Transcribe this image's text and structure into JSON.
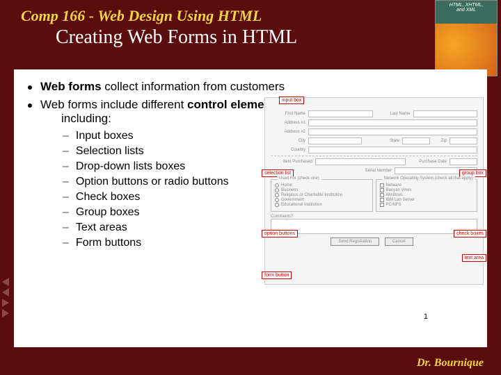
{
  "header": {
    "course": "Comp 166 - Web Design Using HTML",
    "title": "Creating Web Forms in HTML"
  },
  "book": {
    "line1": "HTML, XHTML,",
    "line2": "and XML"
  },
  "bullets": {
    "b1_pre": "Web forms",
    "b1_post": " collect information from customers",
    "b2_pre": "Web forms include different ",
    "b2_bold": "control elements",
    "b2_post": " including:",
    "subs": {
      "s1": "Input boxes",
      "s2": "Selection lists",
      "s3": "Drop-down lists boxes",
      "s4": "Option buttons or radio buttons",
      "s5": "Check boxes",
      "s6": "Group boxes",
      "s7": "Text areas",
      "s8": "Form buttons"
    }
  },
  "diagram": {
    "callouts": {
      "inputbox": "input box",
      "selectionlist": "selection list",
      "optionbuttons": "option buttons",
      "formbutton": "form button",
      "groupbox": "group box",
      "checkboxes": "check boxes",
      "textarea": "text area"
    },
    "labels": {
      "firstname": "First Name",
      "lastname": "Last Name",
      "addr1": "Address #1",
      "addr2": "Address #2",
      "city": "City",
      "state": "State",
      "zip": "Zip",
      "country": "Country",
      "item": "Item Purchased",
      "pdate": "Purchase Date",
      "serial": "Serial Number",
      "usedfor": "Used For (check one)",
      "netos": "Network Operating System (check all that apply)",
      "comments": "Comments?",
      "send": "Send Registration",
      "cancel": "Cancel"
    },
    "opts": {
      "o1": "Home",
      "o2": "Business",
      "o3": "Religious or Charitable Institution",
      "o4": "Government",
      "o5": "Educational Institution",
      "c1": "Netware",
      "c2": "Banyan Vines",
      "c3": "Windows",
      "c4": "IBM Lan Server",
      "c5": "PC/NFS"
    }
  },
  "footer": {
    "author": "Dr. Bournique",
    "page": "1"
  }
}
